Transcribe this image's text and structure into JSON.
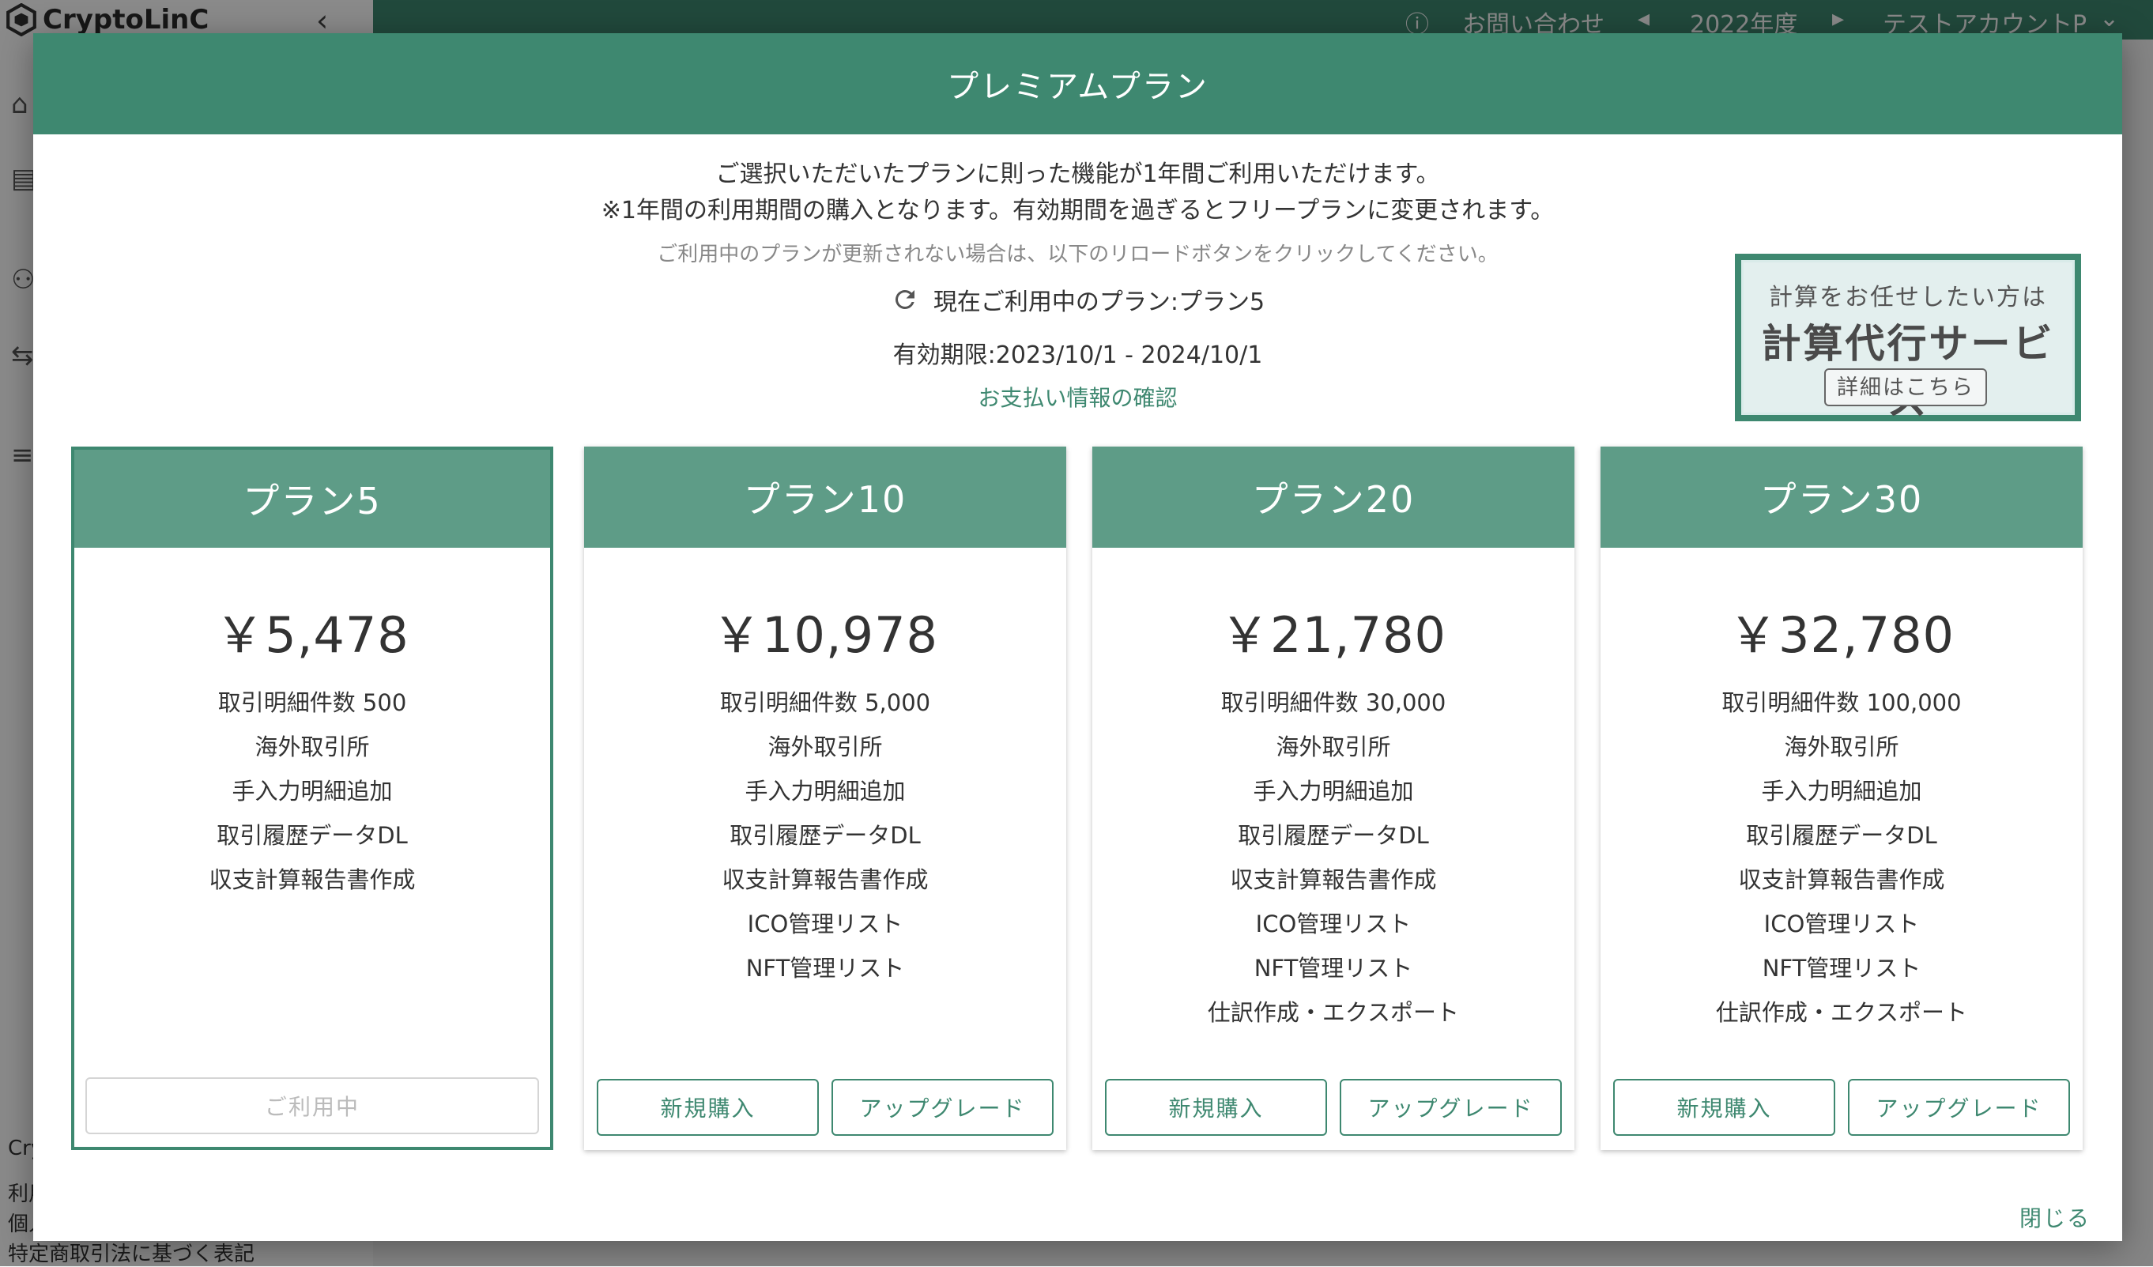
{
  "background": {
    "app_name": "CryptoLinC",
    "topbar": {
      "contact": "お問い合わせ",
      "fiscal_year": "2022年度",
      "account": "テストアカウントP"
    },
    "footer": {
      "line1": "Cry",
      "line2": "利用",
      "line3": "個人",
      "line4": "特定商取引法に基づく表記"
    }
  },
  "modal": {
    "title": "プレミアムプラン",
    "intro_line1": "ご選択いただいたプランに則った機能が1年間ご利用いただけます。",
    "intro_line2": "※1年間の利用期間の購入となります。有効期間を過ぎるとフリープランに変更されます。",
    "reload_note": "ご利用中のプランが更新されない場合は、以下のリロードボタンをクリックしてください。",
    "current_plan": "現在ご利用中のプラン:プラン5",
    "expiry": "有効期限:2023/10/1 - 2024/10/1",
    "payment_link": "お支払い情報の確認",
    "promo": {
      "line1": "計算をお任せしたい方は",
      "line2": "計算代行サービス",
      "button": "詳細はこちら"
    },
    "plans": [
      {
        "name": "プラン5",
        "price": "￥5,478",
        "features": [
          "取引明細件数 500",
          "海外取引所",
          "手入力明細追加",
          "取引履歴データDL",
          "収支計算報告書作成"
        ],
        "status_label": "ご利用中"
      },
      {
        "name": "プラン10",
        "price": "￥10,978",
        "features": [
          "取引明細件数 5,000",
          "海外取引所",
          "手入力明細追加",
          "取引履歴データDL",
          "収支計算報告書作成",
          "ICO管理リスト",
          "NFT管理リスト"
        ],
        "buy_label": "新規購入",
        "upgrade_label": "アップグレード"
      },
      {
        "name": "プラン20",
        "price": "￥21,780",
        "features": [
          "取引明細件数 30,000",
          "海外取引所",
          "手入力明細追加",
          "取引履歴データDL",
          "収支計算報告書作成",
          "ICO管理リスト",
          "NFT管理リスト",
          "仕訳作成・エクスポート"
        ],
        "buy_label": "新規購入",
        "upgrade_label": "アップグレード"
      },
      {
        "name": "プラン30",
        "price": "￥32,780",
        "features": [
          "取引明細件数 100,000",
          "海外取引所",
          "手入力明細追加",
          "取引履歴データDL",
          "収支計算報告書作成",
          "ICO管理リスト",
          "NFT管理リスト",
          "仕訳作成・エクスポート"
        ],
        "buy_label": "新規購入",
        "upgrade_label": "アップグレード"
      }
    ],
    "close_label": "閉じる"
  },
  "colors": {
    "brand": "#3e8870",
    "card_header": "#5e9c87",
    "promo_bg": "#e3efee"
  }
}
